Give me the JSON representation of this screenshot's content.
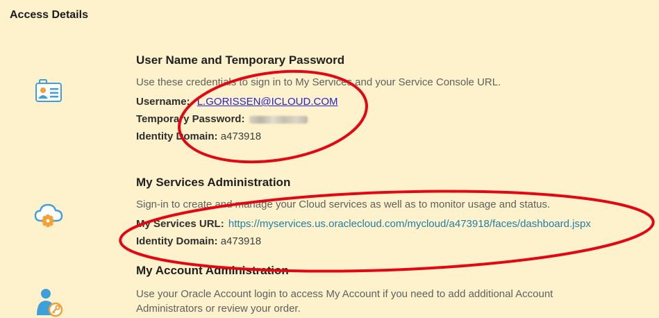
{
  "page": {
    "title": "Access Details"
  },
  "sections": {
    "credentials": {
      "icon": "id-card-icon",
      "title": "User Name and Temporary Password",
      "description": "Use these credentials to sign in to My Services and your Service Console URL.",
      "username_label": "Username:",
      "username_value": "L.GORISSEN@ICLOUD.COM",
      "password_label": "Temporary Password:",
      "domain_label": "Identity Domain:",
      "domain_value": "a473918"
    },
    "my_services": {
      "icon": "cloud-gear-icon",
      "title": "My Services Administration",
      "description": "Sign-in to create and manage your Cloud services as well as to monitor usage and status.",
      "url_label": "My Services URL:",
      "url_value": "https://myservices.us.oraclecloud.com/mycloud/a473918/faces/dashboard.jspx",
      "domain_label": "Identity Domain:",
      "domain_value": "a473918"
    },
    "my_account": {
      "icon": "user-key-icon",
      "title": "My Account Administration",
      "description": "Use your Oracle Account login to access My Account if you need to add additional Account Administrators or review your order."
    }
  },
  "colors": {
    "background": "#fdf2cc",
    "icon_blue": "#3f9fd9",
    "icon_orange": "#f0a035",
    "link_blue": "#2323d6",
    "url_teal": "#1f7fa8",
    "annotation_red": "#e30613"
  }
}
